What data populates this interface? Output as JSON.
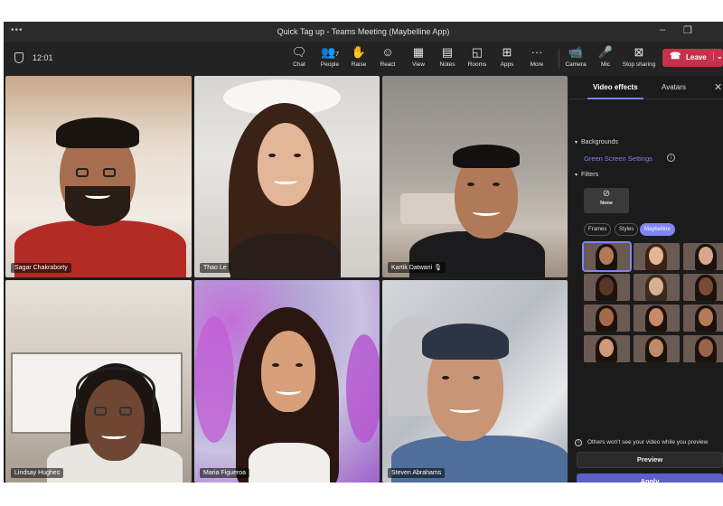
{
  "window": {
    "title": "Quick Tag up - Teams Meeting (Maybelline App)",
    "menu_icon": "more-dots-icon",
    "restore_icon": "restore-window-icon"
  },
  "toolbar": {
    "time": "12:01",
    "buttons": [
      {
        "label": "Chat",
        "icon": "chat-icon"
      },
      {
        "label": "People",
        "icon": "people-icon",
        "count": "7"
      },
      {
        "label": "Raise",
        "icon": "raise-hand-icon"
      },
      {
        "label": "React",
        "icon": "react-icon"
      },
      {
        "label": "View",
        "icon": "view-icon"
      },
      {
        "label": "Notes",
        "icon": "notes-icon"
      },
      {
        "label": "Rooms",
        "icon": "rooms-icon"
      },
      {
        "label": "Apps",
        "icon": "apps-icon"
      },
      {
        "label": "More",
        "icon": "more-icon"
      },
      {
        "label": "Camera",
        "icon": "camera-icon"
      },
      {
        "label": "Mic",
        "icon": "mic-icon"
      },
      {
        "label": "Stop sharing",
        "icon": "stop-sharing-icon"
      }
    ],
    "leave_label": "Leave",
    "leave_color": "#c4314b"
  },
  "participants": [
    {
      "name": "Sagar Chakraborty"
    },
    {
      "name": "Thao Le"
    },
    {
      "name": "Kartik Datwani"
    },
    {
      "name": "Lindsay Hughes"
    },
    {
      "name": "Maria Figueroa"
    },
    {
      "name": "Steven Abrahams"
    }
  ],
  "panel": {
    "tabs": [
      "Video effects",
      "Avatars"
    ],
    "active_tab": "Video effects",
    "backgrounds_label": "Backgrounds",
    "background_link": "Green Screen Settings",
    "filters_label": "Filters",
    "none_label": "None",
    "chips": [
      "Frames",
      "Styles",
      "Maybelline"
    ],
    "active_chip": "Maybelline",
    "notice": "Others won't see your video while you preview",
    "preview_label": "Preview",
    "apply_label": "Apply",
    "accent_color": "#7f85f5",
    "apply_color": "#5b5fc7"
  }
}
